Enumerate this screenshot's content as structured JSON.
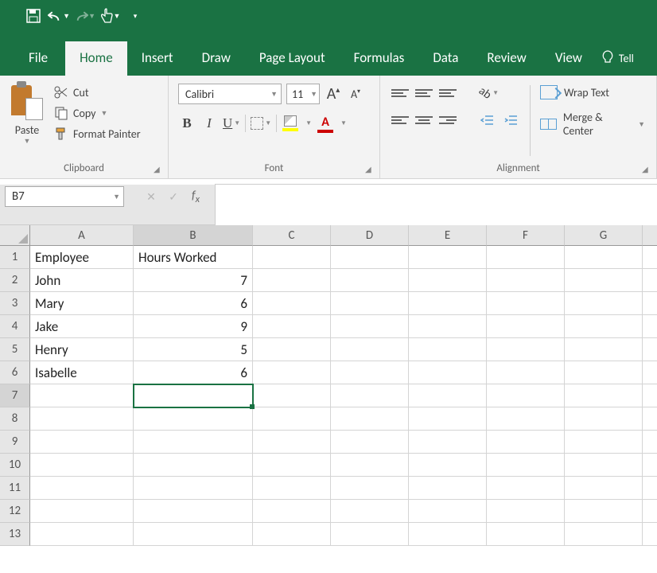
{
  "qat": {
    "save": "save-icon",
    "undo": "undo-icon",
    "redo": "redo-icon",
    "touch": "touch-icon"
  },
  "tabs": {
    "file": "File",
    "home": "Home",
    "insert": "Insert",
    "draw": "Draw",
    "page_layout": "Page Layout",
    "formulas": "Formulas",
    "data": "Data",
    "review": "Review",
    "view": "View",
    "tell": "Tell"
  },
  "clipboard": {
    "paste": "Paste",
    "cut": "Cut",
    "copy": "Copy",
    "format_painter": "Format Painter",
    "group_label": "Clipboard"
  },
  "font": {
    "name": "Calibri",
    "size": "11",
    "group_label": "Font"
  },
  "alignment": {
    "wrap": "Wrap Text",
    "merge": "Merge & Center",
    "group_label": "Alignment"
  },
  "namebox": "B7",
  "formula_value": "",
  "columns": [
    "A",
    "B",
    "C",
    "D",
    "E",
    "F",
    "G"
  ],
  "rows": [
    "1",
    "2",
    "3",
    "4",
    "5",
    "6",
    "7",
    "8",
    "9",
    "10",
    "11",
    "12",
    "13"
  ],
  "selected_col_index": 1,
  "selected_row_index": 6,
  "cells": {
    "A1": "Employee",
    "B1": "Hours Worked",
    "A2": "John",
    "B2": "7",
    "A3": "Mary",
    "B3": "6",
    "A4": "Jake",
    "B4": "9",
    "A5": "Henry",
    "B5": "5",
    "A6": "Isabelle",
    "B6": "6"
  },
  "numeric_cells": [
    "B2",
    "B3",
    "B4",
    "B5",
    "B6"
  ]
}
